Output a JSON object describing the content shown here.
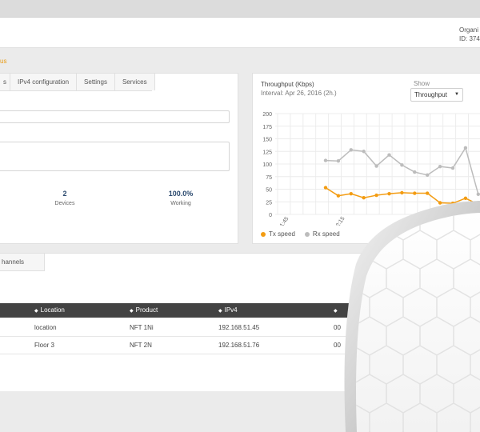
{
  "header": {
    "org_line": "Organi",
    "id_line": "ID: 374"
  },
  "breadcrumb": "us",
  "left_panel": {
    "tabs": [
      "s",
      "IPv4 configuration",
      "Settings",
      "Services"
    ],
    "stats": [
      {
        "value": "2",
        "label": "Devices"
      },
      {
        "value": "100.0%",
        "label": "Working"
      }
    ]
  },
  "throughput": {
    "title": "Throughput (Kbps)",
    "interval": "Interval: Apr 26, 2016 (2h.)",
    "show_label": "Show",
    "show_value": "Throughput"
  },
  "chart_data": {
    "type": "line",
    "title": "Throughput (Kbps)",
    "ylim": [
      0,
      200
    ],
    "y_ticks": [
      200,
      175,
      150,
      125,
      100,
      75,
      50,
      25,
      0
    ],
    "x_tick_labels": [
      "11:45",
      "12:15"
    ],
    "grid": true,
    "legend_position": "bottom-left",
    "series": [
      {
        "name": "Tx speed",
        "color": "#f39c12",
        "values": [
          53,
          37,
          41,
          33,
          38,
          41,
          43,
          42,
          42,
          23,
          22,
          32,
          20
        ]
      },
      {
        "name": "Rx speed",
        "color": "#bcbcbc",
        "values": [
          107,
          106,
          128,
          125,
          96,
          118,
          98,
          84,
          78,
          95,
          92,
          132,
          40
        ]
      }
    ]
  },
  "channels_tab": "hannels",
  "table": {
    "headers": [
      "Location",
      "Product",
      "IPv4",
      ""
    ],
    "rows": [
      {
        "location": "location",
        "product": "NFT 1Ni",
        "ipv4": "192.168.51.45",
        "extra": "00"
      },
      {
        "location": "Floor 3",
        "product": "NFT 2N",
        "ipv4": "192.168.51.76",
        "extra": "00"
      }
    ]
  },
  "colors": {
    "accent": "#f39c12",
    "table_header": "#434343",
    "stat_value": "#2b4a6f"
  }
}
